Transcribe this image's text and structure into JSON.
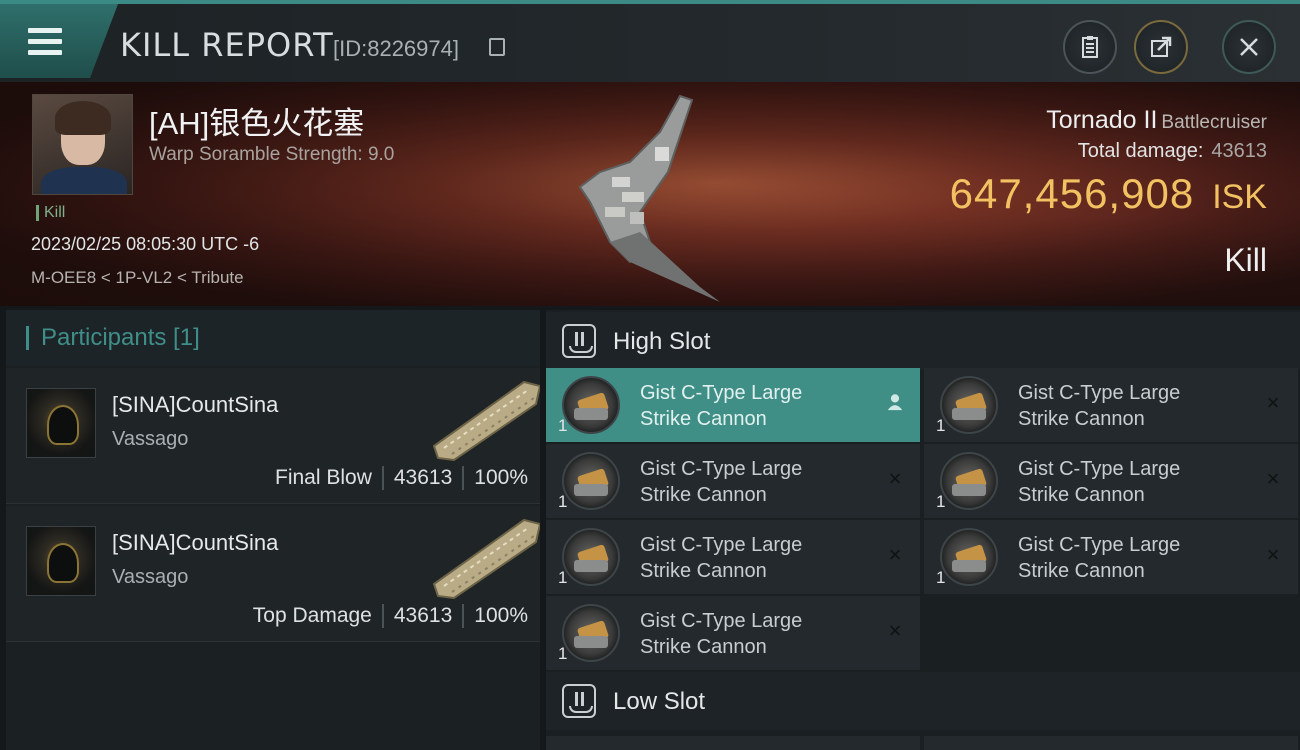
{
  "header": {
    "title": "KILL REPORT",
    "report_id": "[ID:8226974]"
  },
  "victim": {
    "name": "[AH]银色火花塞",
    "subtitle": "Warp Soramble Strength: 9.0",
    "tag": "Kill",
    "time": "2023/02/25 08:05:30 UTC -6",
    "location": "M-OEE8 < 1P-VL2 < Tribute"
  },
  "ship": {
    "name": "Tornado II",
    "class": "Battlecruiser",
    "damage_label": "Total damage:",
    "damage_value": "43613",
    "isk_value": "647,456,908",
    "isk_unit": "ISK",
    "result": "Kill"
  },
  "participants": {
    "title": "Participants [1]",
    "rows": [
      {
        "name": "[SINA]CountSina",
        "ship": "Vassago",
        "role": "Final Blow",
        "damage": "43613",
        "percent": "100%"
      },
      {
        "name": "[SINA]CountSina",
        "ship": "Vassago",
        "role": "Top Damage",
        "damage": "43613",
        "percent": "100%"
      }
    ]
  },
  "slots": {
    "high_title": "High Slot",
    "low_title": "Low Slot",
    "high_modules": [
      {
        "line1": "Gist C-Type Large",
        "line2": "Strike Cannon",
        "qty": "1",
        "status": "person"
      },
      {
        "line1": "Gist C-Type Large",
        "line2": "Strike Cannon",
        "qty": "1",
        "status": "destroyed"
      },
      {
        "line1": "Gist C-Type Large",
        "line2": "Strike Cannon",
        "qty": "1",
        "status": "destroyed"
      },
      {
        "line1": "Gist C-Type Large",
        "line2": "Strike Cannon",
        "qty": "1",
        "status": "destroyed"
      },
      {
        "line1": "Gist C-Type Large",
        "line2": "Strike Cannon",
        "qty": "1",
        "status": "destroyed"
      },
      {
        "line1": "Gist C-Type Large",
        "line2": "Strike Cannon",
        "qty": "1",
        "status": "destroyed"
      },
      {
        "line1": "Gist C-Type Large",
        "line2": "Strike Cannon",
        "qty": "1",
        "status": "destroyed"
      }
    ]
  },
  "icons": {
    "destroyed": "×",
    "person": "👤"
  },
  "colors": {
    "accent": "#3f8f87",
    "isk": "#f2c161"
  }
}
